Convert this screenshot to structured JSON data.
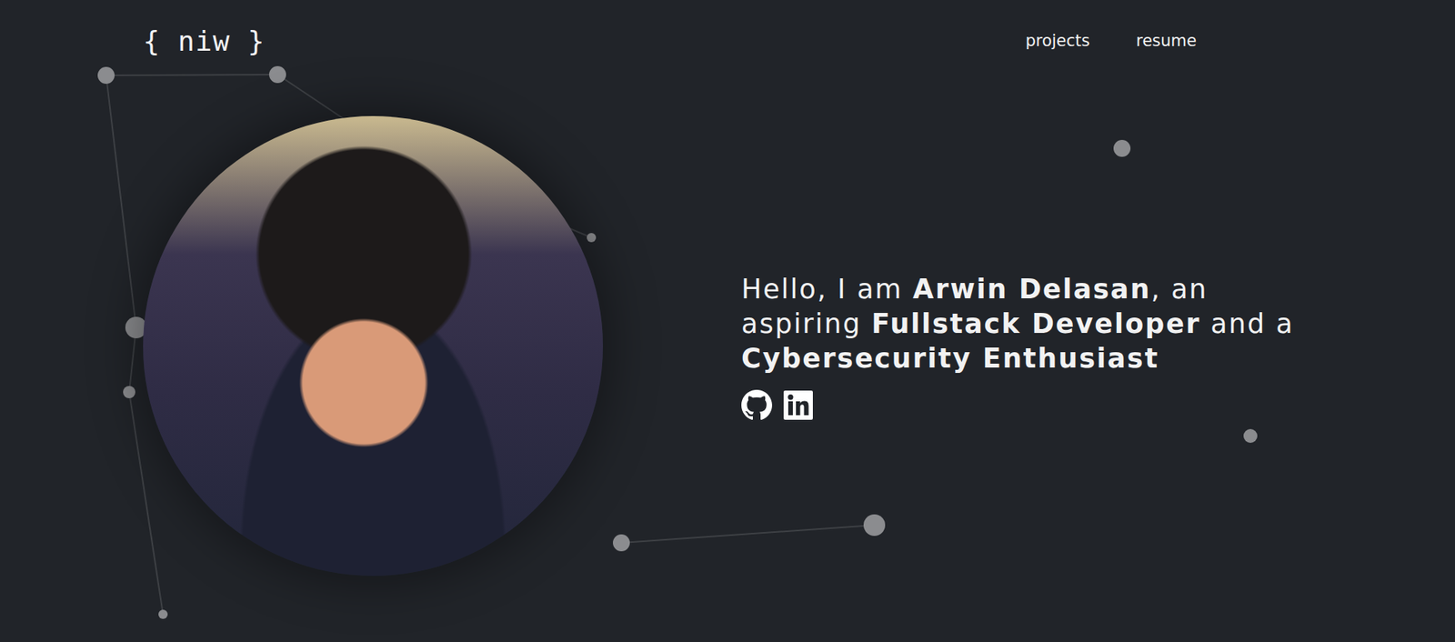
{
  "logo": "{ niw }",
  "nav": [
    {
      "label": "projects"
    },
    {
      "label": "resume"
    }
  ],
  "hero": {
    "segments": [
      {
        "text": "Hello, I am ",
        "bold": false
      },
      {
        "text": "Arwin Delasan",
        "bold": true
      },
      {
        "text": ", an aspiring ",
        "bold": false
      },
      {
        "text": "Fullstack Developer",
        "bold": true
      },
      {
        "text": " and a ",
        "bold": false
      },
      {
        "text": "Cybersecurity Enthusiast",
        "bold": true
      }
    ]
  }
}
